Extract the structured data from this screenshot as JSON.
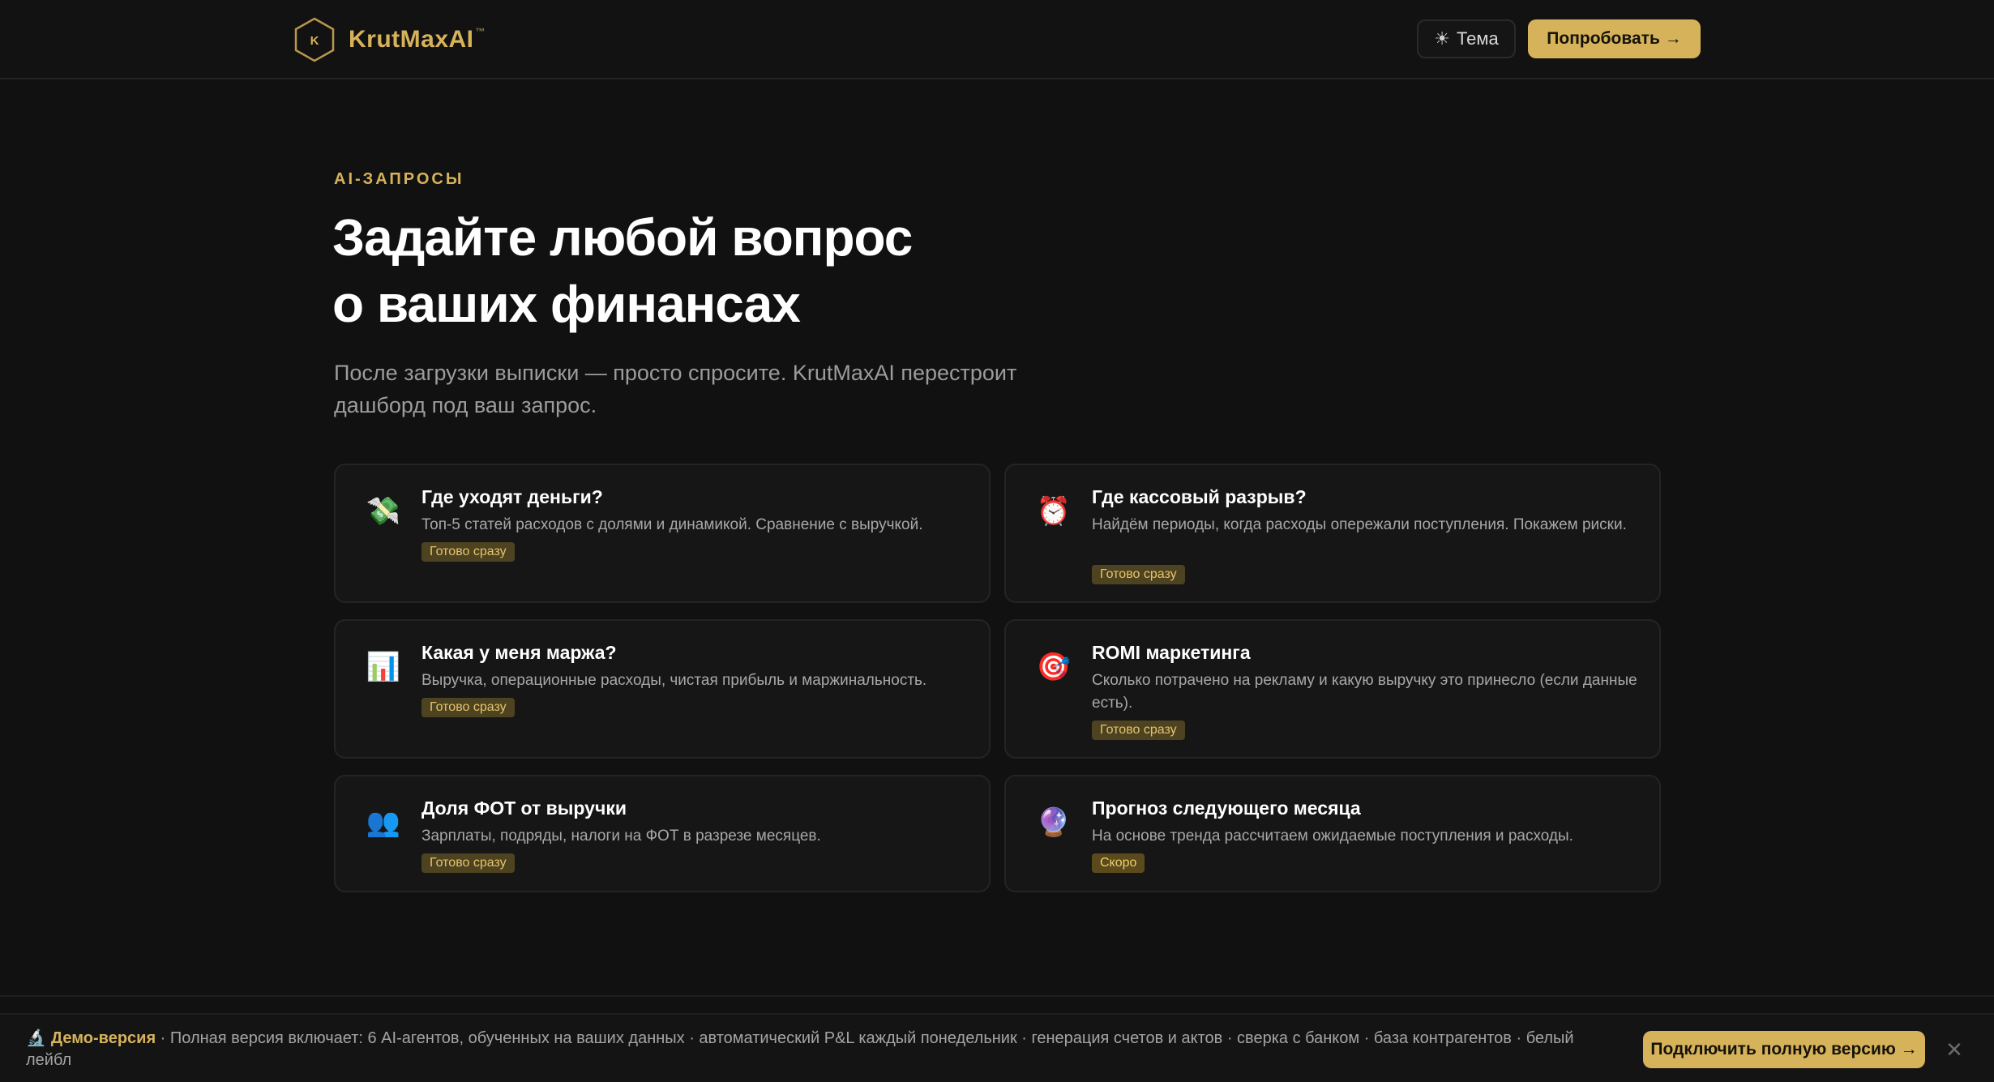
{
  "header": {
    "logo_mark": "K",
    "logo_text": "KrutMaxAI",
    "logo_tm": "™",
    "theme_label": "Тема",
    "try_label": "Попробовать →"
  },
  "hero": {
    "eyebrow": "AI-ЗАПРОСЫ",
    "title_line1": "Задайте любой вопрос",
    "title_line2": "о ваших финансах",
    "subtitle": "После загрузки выписки — просто спросите. KrutMaxAI перестроит дашборд под ваш запрос."
  },
  "cards": [
    {
      "icon": "money-with-wings-icon",
      "emoji": "💸",
      "title": "Где уходят деньги?",
      "desc": "Топ-5 статей расходов с долями и динамикой. Сравнение с выручкой.",
      "badge": "Готово сразу"
    },
    {
      "icon": "alarm-clock-icon",
      "emoji": "⏰",
      "title": "Где кассовый разрыв?",
      "desc": "Найдём периоды, когда расходы опережали поступления. Покажем риски.",
      "badge": "Готово сразу"
    },
    {
      "icon": "bar-chart-icon",
      "emoji": "📊",
      "title": "Какая у меня маржа?",
      "desc": "Выручка, операционные расходы, чистая прибыль и маржинальность.",
      "badge": "Готово сразу"
    },
    {
      "icon": "target-icon",
      "emoji": "🎯",
      "title": "ROMI маркетинга",
      "desc": "Сколько потрачено на рекламу и какую выручку это принесло (если данные есть).",
      "badge": "Готово сразу"
    },
    {
      "icon": "people-icon",
      "emoji": "👥",
      "title": "Доля ФОТ от выручки",
      "desc": "Зарплаты, подряды, налоги на ФОТ в разрезе месяцев.",
      "badge": "Готово сразу"
    },
    {
      "icon": "crystal-ball-icon",
      "emoji": "🔮",
      "title": "Прогноз следующего месяца",
      "desc": "На основе тренда рассчитаем ожидаемые поступления и расходы.",
      "badge": "Скоро"
    }
  ],
  "demo_bar": {
    "icon": "🔬",
    "label": "Демо-версия",
    "text": " · Полная версия включает: 6 AI-агентов, обученных на ваших данных · автоматический P&L каждый понедельник · генерация счетов и актов · сверка с банком · база контрагентов · белый лейбл",
    "button": "Подключить полную версию →",
    "close": "✕"
  },
  "colors": {
    "accent": "#d6b35a",
    "background": "#111111",
    "card": "#161616"
  }
}
